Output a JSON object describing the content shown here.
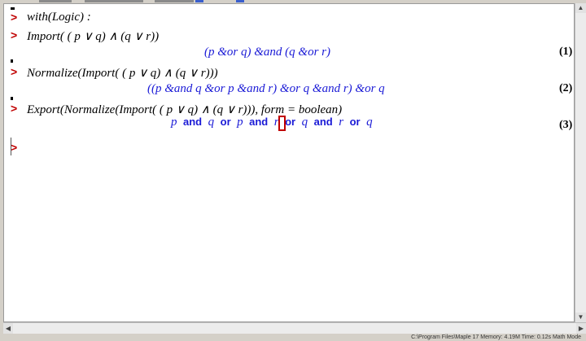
{
  "worksheet": {
    "lines": [
      {
        "prompt": ">",
        "input": "with(Logic) :"
      },
      {
        "prompt": ">",
        "input": "Import( ( p ∨ q) ∧ (q ∨ r))",
        "output": "(p &or q) &and (q &or r)",
        "label": "(1)"
      },
      {
        "prompt": ">",
        "input": "Normalize(Import( ( p ∨ q) ∧ (q ∨ r)))",
        "output": "((p &and q &or p &and r) &or q &and r) &or q",
        "label": "(2)"
      },
      {
        "prompt": ">",
        "input": "Export(Normalize(Import( ( p ∨ q) ∧ (q ∨ r))), form = boolean)",
        "label": "(3)"
      },
      {
        "prompt": ">"
      }
    ],
    "boolean_output": [
      {
        "t": "p",
        "k": false
      },
      {
        "t": "and",
        "k": true
      },
      {
        "t": "q",
        "k": false
      },
      {
        "t": "or",
        "k": true
      },
      {
        "t": "p",
        "k": false
      },
      {
        "t": "and",
        "k": true
      },
      {
        "t": "r",
        "k": false
      },
      {
        "t": "or",
        "k": true
      },
      {
        "t": "q",
        "k": false
      },
      {
        "t": "and",
        "k": true
      },
      {
        "t": "r",
        "k": false
      },
      {
        "t": "or",
        "k": true
      },
      {
        "t": "q",
        "k": false
      }
    ]
  },
  "status_bar": {
    "text": "C:\\Program Files\\Maple 17   Memory: 4.19M   Time: 0.12s   Math Mode"
  },
  "colors": {
    "prompt": "#c00000",
    "output": "#1a1ad6",
    "cursor": "#c00000"
  }
}
